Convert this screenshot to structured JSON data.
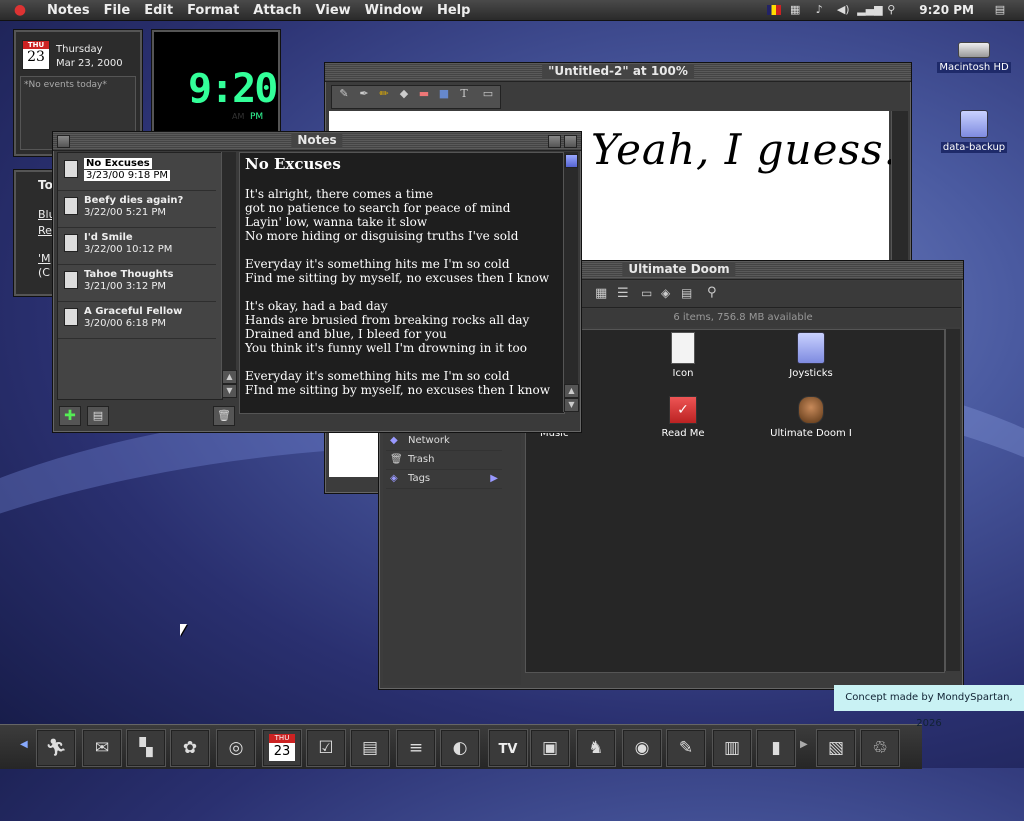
{
  "menubar": {
    "items": [
      "Notes",
      "File",
      "Edit",
      "Format",
      "Attach",
      "View",
      "Window",
      "Help"
    ],
    "clock": "9:20 PM"
  },
  "calendar_widget": {
    "day_abbr": "THU",
    "day_num": "23",
    "weekday": "Thursday",
    "date": "Mar 23, 2000",
    "events": "*No events today*"
  },
  "clock_widget": {
    "time": "9:20",
    "am": "AM",
    "pm": "PM"
  },
  "todo_widget": {
    "title": "To",
    "line1": "Blu",
    "line1b": "Re",
    "line2": "'M",
    "line2b": "(C"
  },
  "desktop": {
    "icons": [
      {
        "label": "Macintosh HD",
        "icon": "hard-drive-icon"
      },
      {
        "label": "data-backup",
        "icon": "folder-icon"
      }
    ]
  },
  "paint_window": {
    "title": "\"Untitled-2\" at 100%",
    "canvas_text": "Yeah, I guess."
  },
  "notes_window": {
    "title": "Notes",
    "list": [
      {
        "title": "No Excuses",
        "date": "3/23/00 9:18 PM"
      },
      {
        "title": "Beefy dies again?",
        "date": "3/22/00 5:21 PM"
      },
      {
        "title": "I'd Smile",
        "date": "3/22/00 10:12 PM"
      },
      {
        "title": "Tahoe Thoughts",
        "date": "3/21/00 3:12 PM"
      },
      {
        "title": "A Graceful Fellow",
        "date": "3/20/00 6:18 PM"
      }
    ],
    "note_title": "No Excuses",
    "note_lines": [
      "It's alright, there comes a time",
      "got no patience to search for peace of mind",
      "Layin' low, wanna take it slow",
      "No more hiding or disguising truths I've sold",
      "",
      "Everyday it's something hits me I'm so cold",
      "Find me sitting by myself, no excuses then I know",
      "",
      "It's okay, had a bad day",
      "Hands are brusied from breaking rocks all day",
      "Drained and blue, I bleed for you",
      "You think it's funny well I'm drowning in it too",
      "",
      "Everyday it's something hits me I'm so cold",
      "FInd me sitting by myself, no excuses then I know"
    ]
  },
  "finder_window": {
    "title": "Ultimate Doom",
    "status": "6 items, 756.8 MB available",
    "sidebar": [
      "Network",
      "Trash",
      "Tags"
    ],
    "partial_label": "Music",
    "items": [
      {
        "label": "Icon"
      },
      {
        "label": "Joysticks"
      },
      {
        "label": "Read Me"
      },
      {
        "label": "Ultimate Doom I"
      }
    ]
  },
  "dock": {
    "apps": [
      "finder",
      "mail",
      "maps",
      "photos",
      "quicktime",
      "calendar",
      "notes-checklist",
      "contacts",
      "textedit",
      "preview",
      "tv",
      "messages",
      "chess",
      "network",
      "stickies",
      "installer",
      "ipod",
      "documents",
      "trash"
    ],
    "calendar_day": "THU",
    "calendar_num": "23",
    "tv_label": "TV"
  },
  "credit": "Concept made by MondySpartan, 2026"
}
